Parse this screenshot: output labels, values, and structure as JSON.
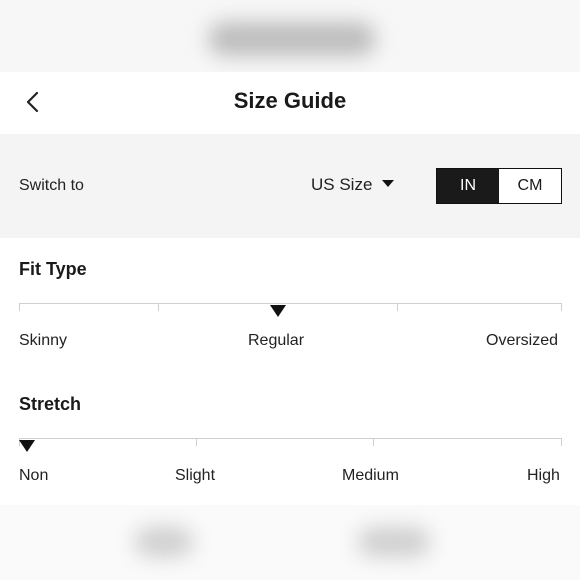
{
  "header": {
    "title": "Size Guide",
    "back_icon": "chevron-left-icon"
  },
  "switch_bar": {
    "label": "Switch to",
    "size_system": "US Size",
    "units": [
      {
        "label": "IN",
        "active": true
      },
      {
        "label": "CM",
        "active": false
      }
    ]
  },
  "fit_type": {
    "title": "Fit Type",
    "labels": [
      "Skinny",
      "Regular",
      "Oversized"
    ],
    "selected": "Regular"
  },
  "stretch": {
    "title": "Stretch",
    "labels": [
      "Non",
      "Slight",
      "Medium",
      "High"
    ],
    "selected": "Non"
  },
  "colors": {
    "accent": "#1a1a1a",
    "bar_background": "#f4f4f4",
    "scale_line": "#cfcfcf"
  }
}
